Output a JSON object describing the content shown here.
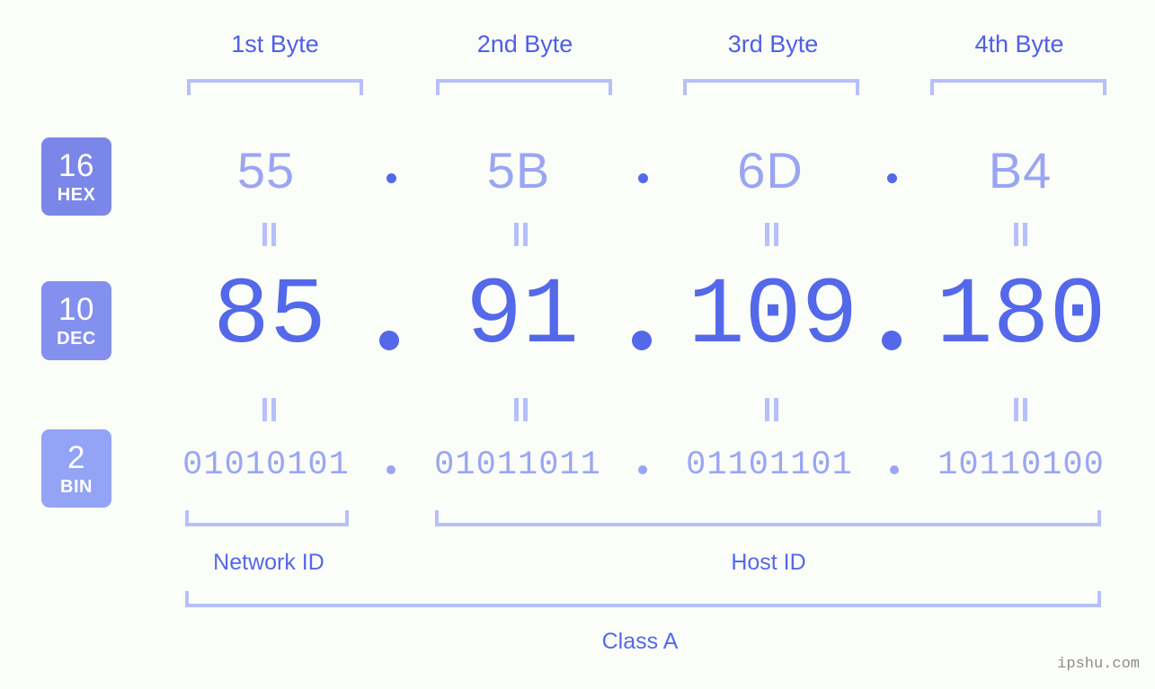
{
  "ip": {
    "address": "85.91.109.180",
    "separator": "."
  },
  "byte_headers": [
    {
      "label": "1st Byte"
    },
    {
      "label": "2nd Byte"
    },
    {
      "label": "3rd Byte"
    },
    {
      "label": "4th Byte"
    }
  ],
  "radix_badges": [
    {
      "number": "16",
      "name": "HEX",
      "color": "#7b87e8"
    },
    {
      "number": "10",
      "name": "DEC",
      "color": "#8490ee"
    },
    {
      "number": "2",
      "name": "BIN",
      "color": "#93a3f5"
    }
  ],
  "rows": {
    "hex": {
      "values": [
        "55",
        "5B",
        "6D",
        "B4"
      ]
    },
    "dec": {
      "values": [
        "85",
        "91",
        "109",
        "180"
      ]
    },
    "bin": {
      "values": [
        "01010101",
        "01011011",
        "01101101",
        "10110100"
      ]
    }
  },
  "equals_symbol": "=",
  "sections": {
    "network_id": "Network ID",
    "host_id": "Host ID",
    "class": "Class A"
  },
  "watermark": "ipshu.com",
  "colors": {
    "background": "#fbfdf9",
    "accent_strong": "#5468ea",
    "accent_mid": "#9aa6f2",
    "accent_light": "#b7c0fb",
    "header_blue": "#4f5fe8"
  }
}
